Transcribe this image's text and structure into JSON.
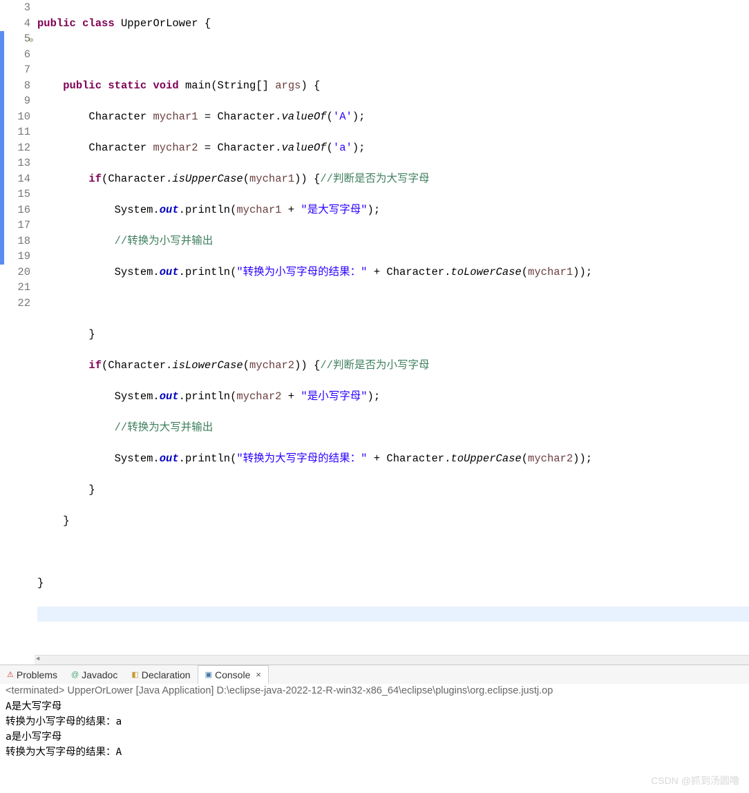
{
  "code": {
    "lines": [
      {
        "n": 3,
        "marker": false
      },
      {
        "n": 4,
        "marker": false
      },
      {
        "n": 5,
        "marker": true,
        "override": true
      },
      {
        "n": 6,
        "marker": true
      },
      {
        "n": 7,
        "marker": true
      },
      {
        "n": 8,
        "marker": true
      },
      {
        "n": 9,
        "marker": true
      },
      {
        "n": 10,
        "marker": true
      },
      {
        "n": 11,
        "marker": true
      },
      {
        "n": 12,
        "marker": true
      },
      {
        "n": 13,
        "marker": true
      },
      {
        "n": 14,
        "marker": true
      },
      {
        "n": 15,
        "marker": true
      },
      {
        "n": 16,
        "marker": true
      },
      {
        "n": 17,
        "marker": true
      },
      {
        "n": 18,
        "marker": true
      },
      {
        "n": 19,
        "marker": true
      },
      {
        "n": 20,
        "marker": false
      },
      {
        "n": 21,
        "marker": false
      },
      {
        "n": 22,
        "marker": false
      }
    ],
    "tokens": {
      "l3": {
        "kw1": "public",
        "kw2": "class",
        "name": "UpperOrLower",
        "brace": "{"
      },
      "l5": {
        "kw1": "public",
        "kw2": "static",
        "kw3": "void",
        "m": "main",
        "args": "(String[] ",
        "argname": "args",
        "close": ") {"
      },
      "l6": {
        "type": "Character ",
        "var": "mychar1",
        "eq": " = Character.",
        "method": "valueOf",
        "arg": "(",
        "chr": "'A'",
        "end": ");"
      },
      "l7": {
        "type": "Character ",
        "var": "mychar2",
        "eq": " = Character.",
        "method": "valueOf",
        "arg": "(",
        "chr": "'a'",
        "end": ");"
      },
      "l8": {
        "kw": "if",
        "open": "(Character.",
        "method": "isUpperCase",
        "arg": "(",
        "var": "mychar1",
        "close": ")) {",
        "comment": "//判断是否为大写字母"
      },
      "l9": {
        "pre": "System.",
        "out": "out",
        "dot": ".println(",
        "var": "mychar1",
        "plus": " + ",
        "str": "\"是大写字母\"",
        "end": ");"
      },
      "l10": {
        "comment": "//转换为小写并输出"
      },
      "l11": {
        "pre": "System.",
        "out": "out",
        "dot": ".println(",
        "str": "\"转换为小写字母的结果：\"",
        "plus": " + Character.",
        "method": "toLowerCase",
        "arg": "(",
        "var": "mychar1",
        "end": "));"
      },
      "l13": {
        "brace": "}"
      },
      "l14": {
        "kw": "if",
        "open": "(Character.",
        "method": "isLowerCase",
        "arg": "(",
        "var": "mychar2",
        "close": ")) {",
        "comment": "//判断是否为小写字母"
      },
      "l15": {
        "pre": "System.",
        "out": "out",
        "dot": ".println(",
        "var": "mychar2",
        "plus": " + ",
        "str": "\"是小写字母\"",
        "end": ");"
      },
      "l16": {
        "comment": "//转换为大写并输出"
      },
      "l17": {
        "pre": "System.",
        "out": "out",
        "dot": ".println(",
        "str": "\"转换为大写字母的结果：\"",
        "plus": " + Character.",
        "method": "toUpperCase",
        "arg": "(",
        "var": "mychar2",
        "end": "));"
      },
      "l18": {
        "brace": "}"
      },
      "l19": {
        "brace": "}"
      },
      "l21": {
        "brace": "}"
      }
    }
  },
  "tabs": {
    "problems": "Problems",
    "javadoc": "Javadoc",
    "declaration": "Declaration",
    "console": "Console"
  },
  "console": {
    "header": "<terminated> UpperOrLower [Java Application] D:\\eclipse-java-2022-12-R-win32-x86_64\\eclipse\\plugins\\org.eclipse.justj.op",
    "out1": "A是大写字母",
    "out2": "转换为小写字母的结果：a",
    "out3": "a是小写字母",
    "out4": "转换为大写字母的结果：A"
  },
  "watermark": "CSDN @抓到汤圆噜"
}
